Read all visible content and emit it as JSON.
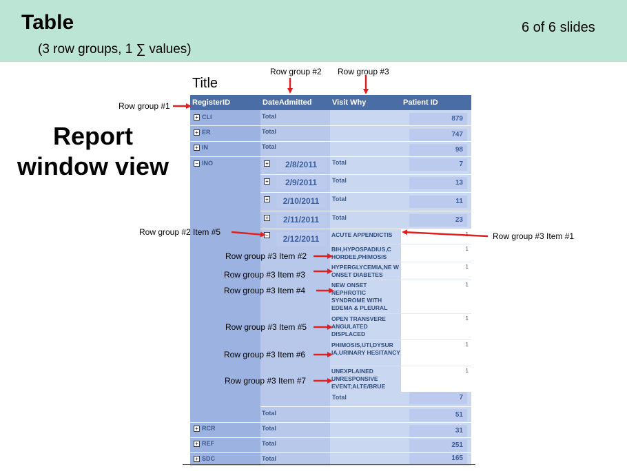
{
  "slide": {
    "title": "Table",
    "subtitle": "(3 row groups, 1 ∑ values)",
    "counter": "6 of 6 slides",
    "side_label_line1": "Report",
    "side_label_line2": "window view"
  },
  "report": {
    "title": "Title",
    "headers": [
      "RegisterID",
      "DateAdmitted",
      "Visit Why",
      "Patient ID"
    ],
    "top_rows": [
      {
        "id": "CLI",
        "label": "Total",
        "value": "879"
      },
      {
        "id": "ER",
        "label": "Total",
        "value": "747"
      },
      {
        "id": "IN",
        "label": "Total",
        "value": "98"
      }
    ],
    "expanded_group": "INO",
    "dates": [
      {
        "date": "2/8/2011",
        "label": "Total",
        "value": "7"
      },
      {
        "date": "2/9/2011",
        "label": "Total",
        "value": "13"
      },
      {
        "date": "2/10/2011",
        "label": "Total",
        "value": "11"
      },
      {
        "date": "2/11/2011",
        "label": "Total",
        "value": "23"
      },
      {
        "date": "2/12/2011"
      }
    ],
    "visit_items": [
      {
        "text": "ACUTE APPENDICTIS",
        "value": "1"
      },
      {
        "text": "BIH,HYPOSPADIUS,C HORDEE,PHIMOSIS",
        "value": "1"
      },
      {
        "text": "HYPERGLYCEMIA,NE W ONSET DIABETES",
        "value": "1"
      },
      {
        "text": "NEW ONSET NEPHROTIC SYNDROME WITH EDEMA & PLEURAL",
        "value": "1"
      },
      {
        "text": "OPEN TRANSVERE ANGULATED DISPLACED",
        "value": "1"
      },
      {
        "text": "PHIMOSIS,UTI,DYSUR IA,URINARY HESITANCY",
        "value": "1"
      },
      {
        "text": "UNEXPLAINED UNRESPONSIVE EVENT;ALTE/BRUE",
        "value": "1"
      }
    ],
    "date_total": {
      "label": "Total",
      "value": "7"
    },
    "group_total": {
      "label": "Total",
      "value": "51"
    },
    "bottom_rows": [
      {
        "id": "RCR",
        "label": "Total",
        "value": "31"
      },
      {
        "id": "REF",
        "label": "Total",
        "value": "251"
      },
      {
        "id": "SDC",
        "label": "Total",
        "value": "165"
      }
    ]
  },
  "annotations": {
    "rg1": "Row group #1",
    "rg2": "Row group #2",
    "rg3": "Row group #3",
    "rg2_item5": "Row group #2 Item #5",
    "rg3_item1": "Row group #3 Item #1",
    "rg3_item2": "Row group #3 Item #2",
    "rg3_item3": "Row group #3 Item #3",
    "rg3_item4": "Row group #3 Item #4",
    "rg3_item5": "Row group #3 Item #5",
    "rg3_item6": "Row group #3 Item #6",
    "rg3_item7": "Row group #3 Item #7"
  },
  "colors": {
    "header_band": "#bde5d6",
    "arrow": "#e02020",
    "table_header": "#4b6da6"
  }
}
